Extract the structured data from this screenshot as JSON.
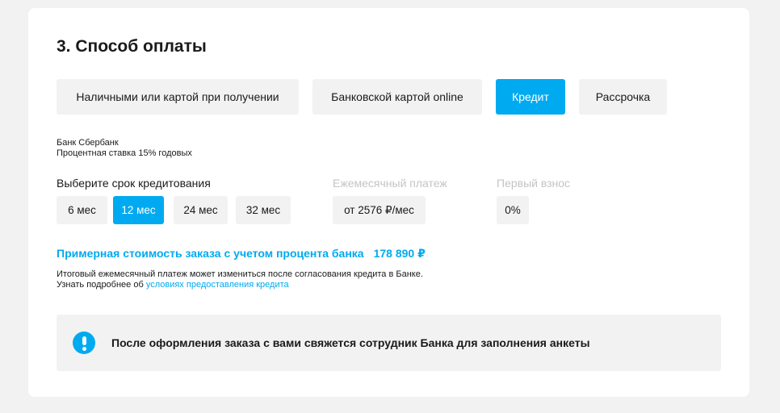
{
  "section": {
    "title": "3. Способ оплаты"
  },
  "payment_methods": [
    {
      "label": "Наличными или картой при получении",
      "selected": false
    },
    {
      "label": "Банковской картой online",
      "selected": false
    },
    {
      "label": "Кредит",
      "selected": true
    },
    {
      "label": "Рассрочка",
      "selected": false
    }
  ],
  "bank": {
    "name": "Банк Сбербанк",
    "rate": "Процентная ставка 15% годовых"
  },
  "term": {
    "label": "Выберите срок кредитования",
    "options": [
      {
        "label": "6 мес",
        "selected": false
      },
      {
        "label": "12 мес",
        "selected": true
      },
      {
        "label": "24 мес",
        "selected": false
      },
      {
        "label": "32 мес",
        "selected": false
      }
    ]
  },
  "monthly": {
    "label": "Ежемесячный платеж",
    "value": "от 2576 ₽/мес"
  },
  "down_payment": {
    "label": "Первый взнос",
    "value": "0%"
  },
  "total": {
    "label": "Примерная стоимость заказа с учетом процента банка",
    "amount": "178 890 ₽"
  },
  "note": {
    "line1": "Итоговый ежемесячный платеж может измениться после согласования кредита в Банке.",
    "line2_prefix": "Узнать подробнее об",
    "link": "условиях предоставления кредита"
  },
  "alert": {
    "icon": "exclamation-icon",
    "text": "После оформления заказа с вами свяжется сотрудник Банка для заполнения анкеты"
  },
  "colors": {
    "accent": "#00aaf0",
    "chip_bg": "#f2f2f2",
    "muted_label": "#c4c4c4"
  }
}
